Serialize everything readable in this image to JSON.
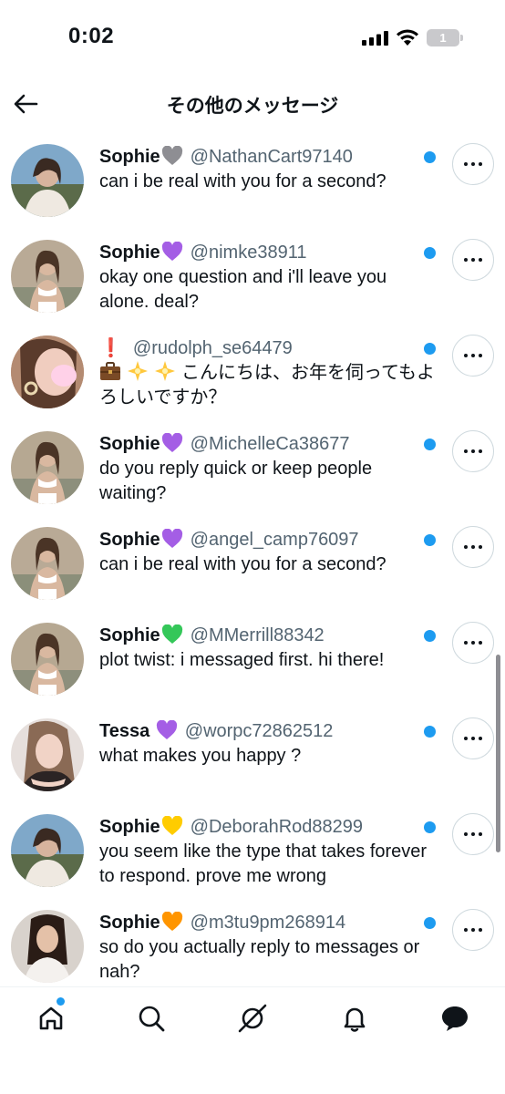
{
  "status_bar": {
    "time": "0:02",
    "battery": "1"
  },
  "header": {
    "title": "その他のメッセージ"
  },
  "messages": [
    {
      "name": "Sophie",
      "heart_color": "#8e8e93",
      "handle": "@NathanCart97140",
      "text": "can i be real with you for a second?"
    },
    {
      "name": "Sophie",
      "heart_color": "#a45ee5",
      "handle": "@nimke38911",
      "text": "okay one question and i'll leave you alone. deal?"
    },
    {
      "name": "",
      "heart_color": "",
      "mark": "❗",
      "handle": "@rudolph_se64479",
      "emoji": [
        "briefcase-icon",
        "sparkle-star-icon",
        "sparkle-star-icon"
      ],
      "text": "こんにちは、お年を伺ってもよろしいですか？"
    },
    {
      "name": "Sophie",
      "heart_color": "#a45ee5",
      "handle": "@MichelleCa38677",
      "text": "do you reply quick or keep people waiting?"
    },
    {
      "name": "Sophie",
      "heart_color": "#a45ee5",
      "handle": "@angel_camp76097",
      "text": "can i be real with you for a second?"
    },
    {
      "name": "Sophie",
      "heart_color": "#34c759",
      "handle": "@MMerrill88342",
      "text": "plot twist: i messaged first. hi there!"
    },
    {
      "name": "Tessa ",
      "heart_color": "#a45ee5",
      "handle": "@worpc72862512",
      "text": "what makes you happy ?"
    },
    {
      "name": "Sophie",
      "heart_color": "#ffcc00",
      "handle": "@DeborahRod88299",
      "text": "you seem like the type that takes forever to respond. prove me wrong"
    },
    {
      "name": "Sophie",
      "heart_color": "#ff9500",
      "handle": "@m3tu9pm268914",
      "text": "so do you actually reply to messages or nah?"
    }
  ],
  "tabbar": {
    "items": [
      "home-icon",
      "search-icon",
      "grok-icon",
      "notifications-icon",
      "messages-icon"
    ],
    "home_has_notification": true
  },
  "colors": {
    "accent": "#1d9bf0",
    "text": "#0f1419",
    "secondary": "#536471"
  }
}
